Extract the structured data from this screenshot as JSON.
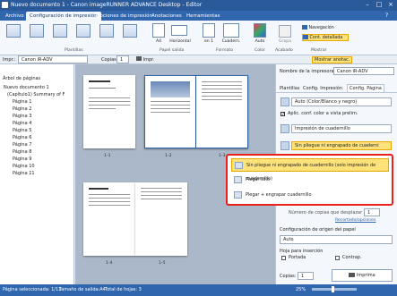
{
  "window": {
    "title": "Nuevo documento 1 - Canon imageRUNNER ADVANCE Desktop - Editor"
  },
  "tabs": [
    "Archivo",
    "Configuración de impresión",
    "Opciones de impresión",
    "Anotaciones",
    "Herramientas"
  ],
  "ribbon": {
    "group_plantillas": "Plantillas",
    "a4": "A4",
    "horizontal": "Horizontal",
    "papel_salida": "Papel salida",
    "en1": "en 1",
    "cuadern": "Cuadern.",
    "formato": "Formato",
    "auto": "Auto",
    "color": "Color",
    "grapa": "Grapa",
    "acabado": "Acabado",
    "navegacion": "Navegación",
    "cont_detallada": "Cont. detallada",
    "mostrar": "Mostrar"
  },
  "toolbar": {
    "impr_label": "Impr.:",
    "printer": "Canon iR-ADV",
    "copias_label": "Copias:",
    "copias_val": "1",
    "impr_btn": "Impr.",
    "mostrar_anotac": "Mostrar anotac."
  },
  "tree": {
    "header": "Árbol de páginas",
    "items": [
      "Nuevo documento 1",
      "(Capítulo1) Summary of F",
      "Página 1",
      "Página 2",
      "Página 3",
      "Página 4",
      "Página 5",
      "Página 6",
      "Página 7",
      "Página 8",
      "Página 9",
      "Página 10",
      "Página 11"
    ]
  },
  "pages": {
    "labels": [
      "1-1",
      "1-2",
      "1-3",
      "1-4",
      "1-5"
    ]
  },
  "rightpane": {
    "printer_label": "Nombre de la impresora:",
    "printer_value": "Canon iR-ADV",
    "tabs": [
      "Plantillas",
      "Config. Impresión",
      "Config. Página"
    ],
    "color_mode": "Auto (Color/Blanco y negro)",
    "apply_label": "Aplic. conf. color a vista prelim.",
    "print_mode": "Impresión de cuadernillo",
    "binding_value": "Sin pliegue ni engrapado de cuaderni",
    "copies_label": "Número de copias que desplazar",
    "copies_value": "1",
    "trim_link": "Recortado/opciones",
    "source_label": "Configuración de origen del papel",
    "source_value": "Auto",
    "insert_label": "Hoja para inserción",
    "front_label": "Portada",
    "back_label": "Contrap.",
    "copies2_label": "Copias:",
    "copies2_value": "1",
    "print_btn": "Imprima"
  },
  "popup": {
    "items": [
      "Sin pliegue ni engrapado de cuadernillo (solo impresión de cuadernillo)",
      "Plegar sólo",
      "Plegar + engrapar cuadernillo"
    ]
  },
  "status": {
    "pages_selected": "Página seleccionada: 1/11",
    "output_size": "Tamaño de salida:A4",
    "total": "Total de hojas: 3",
    "zoom": "25%"
  },
  "colors": {
    "accent": "#2f66ae",
    "popup_border": "#e8211d",
    "highlight": "#ffe27a"
  }
}
